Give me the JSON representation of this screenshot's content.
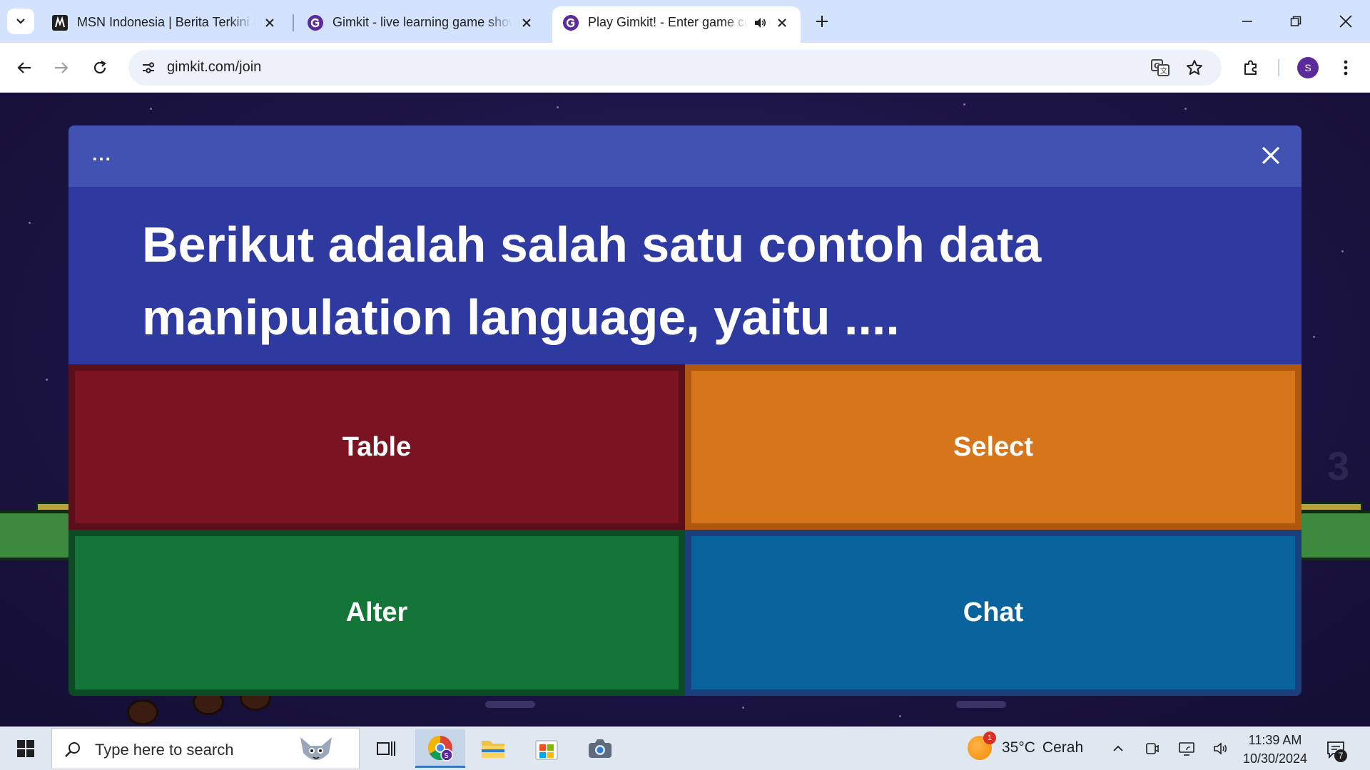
{
  "browser": {
    "tabs": [
      {
        "title": "MSN Indonesia | Berita Terkini Hari Ini",
        "favicon": "msn-icon",
        "active": false
      },
      {
        "title": "Gimkit - live learning game show",
        "favicon": "gimkit-icon",
        "active": false
      },
      {
        "title": "Play Gimkit! - Enter game code",
        "favicon": "gimkit-icon",
        "active": true,
        "audio": true
      }
    ],
    "url": "gimkit.com/join",
    "profile_initial": "S"
  },
  "game": {
    "more_label": "...",
    "question": "Berikut adalah salah satu contoh data manipulation language, yaitu ....",
    "answers": [
      {
        "label": "Table",
        "color": "#7b1323"
      },
      {
        "label": "Select",
        "color": "#d7751a"
      },
      {
        "label": "Alter",
        "color": "#137537"
      },
      {
        "label": "Chat",
        "color": "#09649d"
      }
    ],
    "background_number": "3"
  },
  "taskbar": {
    "search_placeholder": "Type here to search",
    "weather": {
      "temp": "35°C",
      "condition": "Cerah",
      "badge": "1"
    },
    "clock": {
      "time": "11:39 AM",
      "date": "10/30/2024"
    },
    "notifications": "7"
  }
}
